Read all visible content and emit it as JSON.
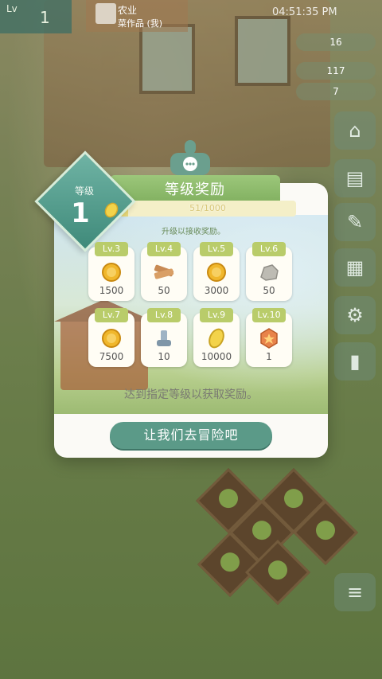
{
  "hud": {
    "level_prefix": "Lv",
    "level": "1",
    "profile_line1": "农业",
    "profile_line2": "菜作品 (我)",
    "clock": "04:51:35 PM",
    "stat_1": "16",
    "stat_2": "117",
    "stat_3": "7"
  },
  "modal": {
    "badge_label": "等级",
    "badge_level": "1",
    "title": "等级奖励",
    "exp_text": "51/1000",
    "exp_progress_fraction": 0.051,
    "hint": "升级以接收奖励。",
    "rewards": [
      {
        "lv": "Lv.3",
        "amount": "1500",
        "icon": "gold-coin-icon"
      },
      {
        "lv": "Lv.4",
        "amount": "50",
        "icon": "wood-plank-icon"
      },
      {
        "lv": "Lv.5",
        "amount": "3000",
        "icon": "gold-coin-icon"
      },
      {
        "lv": "Lv.6",
        "amount": "50",
        "icon": "stone-icon"
      },
      {
        "lv": "Lv.7",
        "amount": "7500",
        "icon": "gold-coin-icon"
      },
      {
        "lv": "Lv.8",
        "amount": "10",
        "icon": "metal-bolt-icon"
      },
      {
        "lv": "Lv.9",
        "amount": "10000",
        "icon": "leaf-gem-icon"
      },
      {
        "lv": "Lv.10",
        "amount": "1",
        "icon": "orange-badge-icon"
      }
    ],
    "description": "达到指定等级以获取奖励。",
    "button_label": "让我们去冒险吧"
  },
  "colors": {
    "accent_teal": "#5b9a88",
    "ribbon_green": "#8bbd6b",
    "level_tag": "#b9cc6a"
  }
}
